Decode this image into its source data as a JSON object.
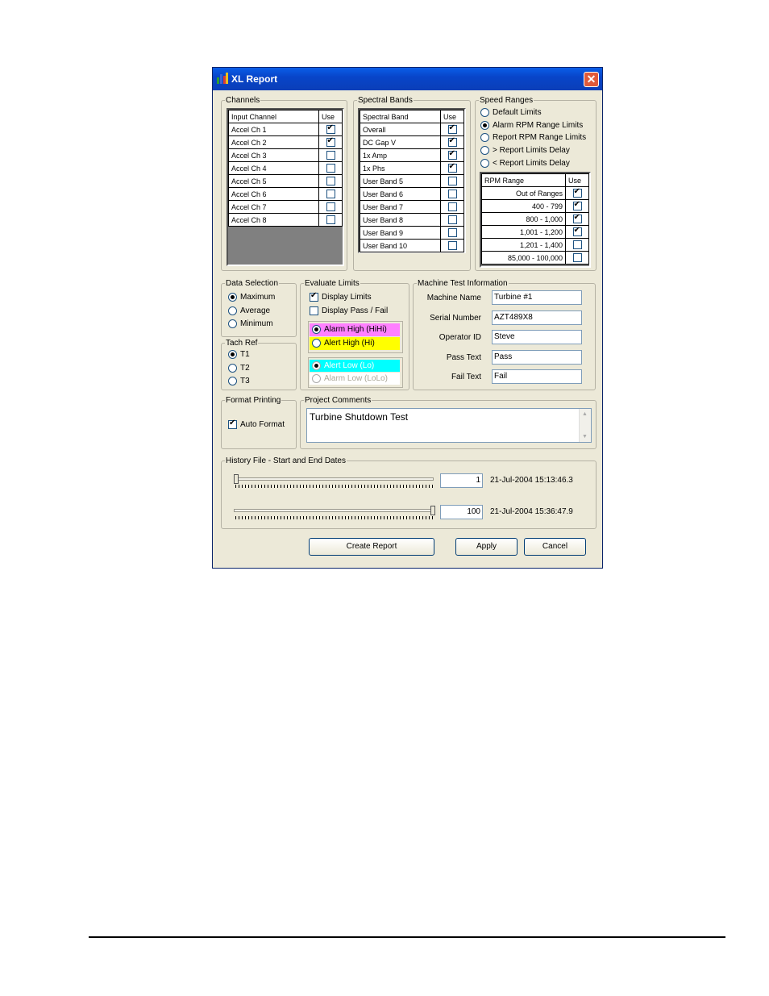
{
  "window": {
    "title": "XL Report",
    "close_glyph": "✕"
  },
  "channels": {
    "label": "Channels",
    "headers": [
      "Input Channel",
      "Use"
    ],
    "rows": [
      {
        "name": "Accel Ch 1",
        "use": true
      },
      {
        "name": "Accel Ch 2",
        "use": true
      },
      {
        "name": "Accel Ch 3",
        "use": false
      },
      {
        "name": "Accel Ch 4",
        "use": false
      },
      {
        "name": "Accel Ch 5",
        "use": false
      },
      {
        "name": "Accel Ch 6",
        "use": false
      },
      {
        "name": "Accel Ch 7",
        "use": false
      },
      {
        "name": "Accel Ch 8",
        "use": false
      }
    ]
  },
  "spectral_bands": {
    "label": "Spectral Bands",
    "headers": [
      "Spectral Band",
      "Use"
    ],
    "rows": [
      {
        "name": "Overall",
        "use": true
      },
      {
        "name": "DC Gap V",
        "use": true
      },
      {
        "name": "1x Amp",
        "use": true
      },
      {
        "name": "1x Phs",
        "use": true
      },
      {
        "name": "User Band 5",
        "use": false
      },
      {
        "name": "User Band 6",
        "use": false
      },
      {
        "name": "User Band 7",
        "use": false
      },
      {
        "name": "User Band 8",
        "use": false
      },
      {
        "name": "User Band 9",
        "use": false
      },
      {
        "name": "User Band 10",
        "use": false
      }
    ]
  },
  "speed_ranges": {
    "label": "Speed Ranges",
    "options": [
      {
        "label": "Default Limits",
        "selected": false
      },
      {
        "label": "Alarm RPM Range Limits",
        "selected": true
      },
      {
        "label": "Report RPM Range Limits",
        "selected": false
      },
      {
        "label": "> Report Limits Delay",
        "selected": false
      },
      {
        "label": "< Report Limits Delay",
        "selected": false
      }
    ],
    "headers": [
      "RPM Range",
      "Use"
    ],
    "rows": [
      {
        "name": "Out of Ranges",
        "use": true
      },
      {
        "name": "400 - 799",
        "use": true
      },
      {
        "name": "800 - 1,000",
        "use": true
      },
      {
        "name": "1,001 - 1,200",
        "use": true
      },
      {
        "name": "1,201 - 1,400",
        "use": false
      },
      {
        "name": "85,000 - 100,000",
        "use": false
      }
    ]
  },
  "data_selection": {
    "label": "Data Selection",
    "options": [
      {
        "label": "Maximum",
        "selected": true
      },
      {
        "label": "Average",
        "selected": false
      },
      {
        "label": "Minimum",
        "selected": false
      }
    ]
  },
  "tach_ref": {
    "label": "Tach Ref",
    "options": [
      {
        "label": "T1",
        "selected": true
      },
      {
        "label": "T2",
        "selected": false
      },
      {
        "label": "T3",
        "selected": false
      }
    ]
  },
  "evaluate_limits": {
    "label": "Evaluate Limits",
    "display_limits": {
      "label": "Display Limits",
      "checked": true
    },
    "display_pass_fail": {
      "label": "Display Pass / Fail",
      "checked": false
    },
    "high_options": [
      {
        "label": "Alarm High (HiHi)",
        "selected": true,
        "color": "#ff80ff"
      },
      {
        "label": "Alert High (Hi)",
        "selected": false,
        "color": "#ffff00"
      }
    ],
    "low_options": [
      {
        "label": "Alert Low (Lo)",
        "selected": true,
        "color": "#00ffff"
      },
      {
        "label": "Alarm Low (LoLo)",
        "selected": false,
        "color": "#ffffff"
      }
    ]
  },
  "machine_info": {
    "label": "Machine Test Information",
    "fields": [
      {
        "label": "Machine Name",
        "value": "Turbine #1"
      },
      {
        "label": "Serial Number",
        "value": "AZT489X8"
      },
      {
        "label": "Operator ID",
        "value": "Steve"
      },
      {
        "label": "Pass Text",
        "value": "Pass"
      },
      {
        "label": "Fail Text",
        "value": "Fail"
      }
    ]
  },
  "format_printing": {
    "label": "Format Printing",
    "auto_format": {
      "label": "Auto Format",
      "checked": true
    }
  },
  "project_comments": {
    "label": "Project Comments",
    "value": "Turbine Shutdown Test"
  },
  "history": {
    "label": "History File - Start and End Dates",
    "start": {
      "value": "1",
      "date": "21-Jul-2004 15:13:46.3",
      "position": 0.0
    },
    "end": {
      "value": "100",
      "date": "21-Jul-2004 15:36:47.9",
      "position": 1.0
    }
  },
  "buttons": {
    "create_report": "Create Report",
    "apply": "Apply",
    "cancel": "Cancel"
  }
}
